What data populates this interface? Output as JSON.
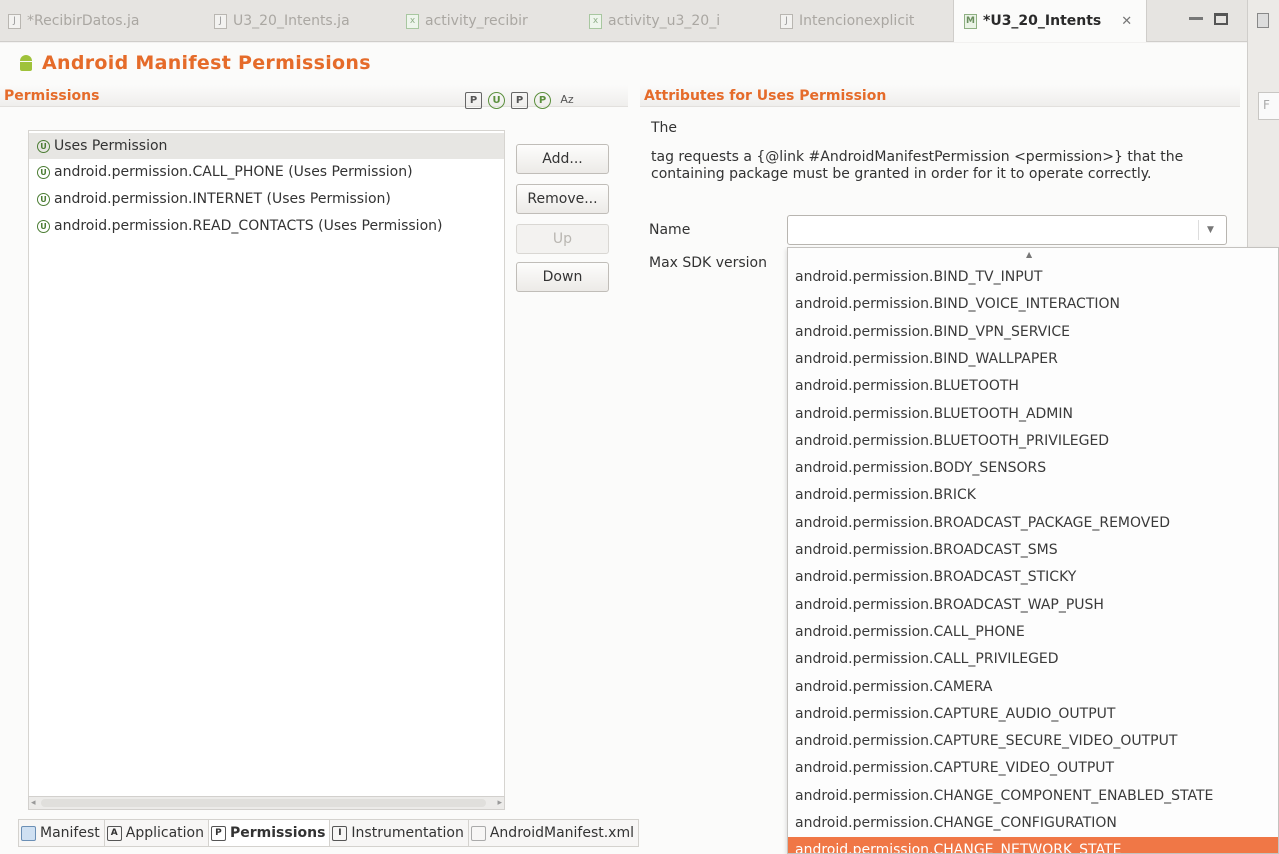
{
  "editor_tabs": [
    {
      "label": "*RecibirDatos.ja",
      "kind": "java",
      "active": false
    },
    {
      "label": "U3_20_Intents.ja",
      "kind": "java",
      "active": false
    },
    {
      "label": "activity_recibir",
      "kind": "xml",
      "active": false
    },
    {
      "label": "activity_u3_20_i",
      "kind": "xml",
      "active": false
    },
    {
      "label": "Intencionexplicit",
      "kind": "java",
      "active": false
    },
    {
      "label": "*U3_20_Intents",
      "kind": "manifest",
      "active": true
    }
  ],
  "page_title": "Android Manifest Permissions",
  "permissions": {
    "header": "Permissions",
    "sort_icons": [
      "P",
      "U",
      "P",
      "P",
      "Az"
    ],
    "items": [
      "Uses Permission",
      "android.permission.CALL_PHONE (Uses Permission)",
      "android.permission.INTERNET (Uses Permission)",
      "android.permission.READ_CONTACTS (Uses Permission)"
    ],
    "selected_index": 0
  },
  "buttons": {
    "add": "Add...",
    "remove": "Remove...",
    "up": "Up",
    "down": "Down"
  },
  "attributes": {
    "header": "Attributes for Uses Permission",
    "intro": "The",
    "description": "tag requests a {@link #AndroidManifestPermission <permission>} that the containing package must be granted in order for it to operate correctly.",
    "name_label": "Name",
    "name_value": "",
    "max_sdk_label": "Max SDK version"
  },
  "dropdown_options": [
    "android.permission.BIND_TV_INPUT",
    "android.permission.BIND_VOICE_INTERACTION",
    "android.permission.BIND_VPN_SERVICE",
    "android.permission.BIND_WALLPAPER",
    "android.permission.BLUETOOTH",
    "android.permission.BLUETOOTH_ADMIN",
    "android.permission.BLUETOOTH_PRIVILEGED",
    "android.permission.BODY_SENSORS",
    "android.permission.BRICK",
    "android.permission.BROADCAST_PACKAGE_REMOVED",
    "android.permission.BROADCAST_SMS",
    "android.permission.BROADCAST_STICKY",
    "android.permission.BROADCAST_WAP_PUSH",
    "android.permission.CALL_PHONE",
    "android.permission.CALL_PRIVILEGED",
    "android.permission.CAMERA",
    "android.permission.CAPTURE_AUDIO_OUTPUT",
    "android.permission.CAPTURE_SECURE_VIDEO_OUTPUT",
    "android.permission.CAPTURE_VIDEO_OUTPUT",
    "android.permission.CHANGE_COMPONENT_ENABLED_STATE",
    "android.permission.CHANGE_CONFIGURATION",
    "android.permission.CHANGE_NETWORK_STATE"
  ],
  "dropdown_highlight_index": 21,
  "page_tabs": [
    {
      "label": "Manifest",
      "icon": "manifest",
      "active": false
    },
    {
      "label": "Application",
      "icon": "A",
      "active": false
    },
    {
      "label": "Permissions",
      "icon": "P",
      "active": true
    },
    {
      "label": "Instrumentation",
      "icon": "I",
      "active": false
    },
    {
      "label": "AndroidManifest.xml",
      "icon": "xml",
      "active": false
    }
  ],
  "colors": {
    "accent": "#e56b2a",
    "highlight": "#f07746",
    "uses_badge": "#4c7d34"
  }
}
